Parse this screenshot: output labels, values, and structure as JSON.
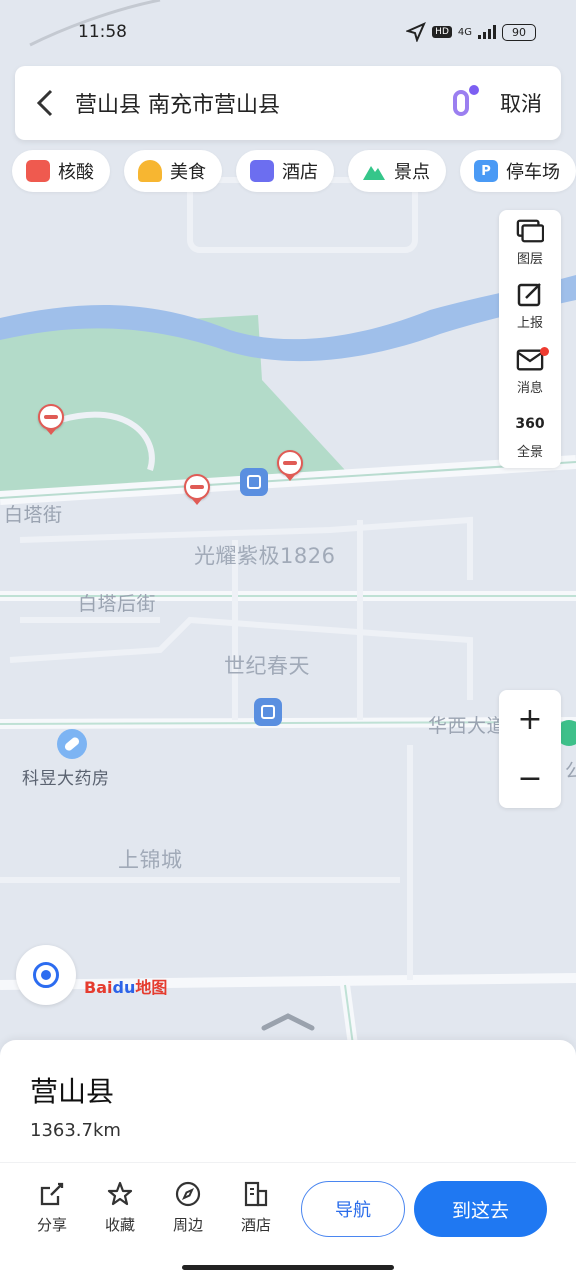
{
  "status_bar": {
    "time": "11:58",
    "network": "4G",
    "hd": "HD",
    "battery": "90"
  },
  "search": {
    "back_icon": "chevron-left-icon",
    "query": "营山县 南充市营山县",
    "mic_icon": "mic-icon",
    "cancel_label": "取消"
  },
  "chips": [
    {
      "label": "核酸",
      "icon": "test-tube-icon",
      "color": "#ef5a4f"
    },
    {
      "label": "美食",
      "icon": "food-icon",
      "color": "#f7b631"
    },
    {
      "label": "酒店",
      "icon": "hotel-icon",
      "color": "#6c6ef0"
    },
    {
      "label": "景点",
      "icon": "mountain-icon",
      "color": "#35c68a"
    },
    {
      "label": "停车场",
      "icon": "parking-icon",
      "color": "#4a9af5"
    }
  ],
  "map_tools": [
    {
      "label": "图层",
      "icon": "layers-icon"
    },
    {
      "label": "上报",
      "icon": "report-icon"
    },
    {
      "label": "消息",
      "icon": "mail-icon",
      "badge": true
    },
    {
      "label": "全景",
      "icon": "panorama-360-icon",
      "glyph": "360"
    }
  ],
  "zoom": {
    "in": "+",
    "out": "−"
  },
  "map_labels": {
    "street1": "白塔街",
    "area1": "光耀紫极1826",
    "street2": "白塔后街",
    "area2": "世纪春天",
    "street3": "华西大道",
    "area3_partial": "公",
    "pharmacy": "科昱大药房",
    "area4": "上锦城"
  },
  "logo": {
    "prefix": "Bai",
    "middle": "du",
    "suffix": "地图"
  },
  "place": {
    "name": "营山县",
    "distance": "1363.7km"
  },
  "actions": [
    {
      "label": "分享",
      "icon": "share-icon"
    },
    {
      "label": "收藏",
      "icon": "star-icon"
    },
    {
      "label": "周边",
      "icon": "compass-icon"
    },
    {
      "label": "酒店",
      "icon": "hotel-icon"
    }
  ],
  "buttons": {
    "navigate": "导航",
    "go_here": "到这去"
  }
}
